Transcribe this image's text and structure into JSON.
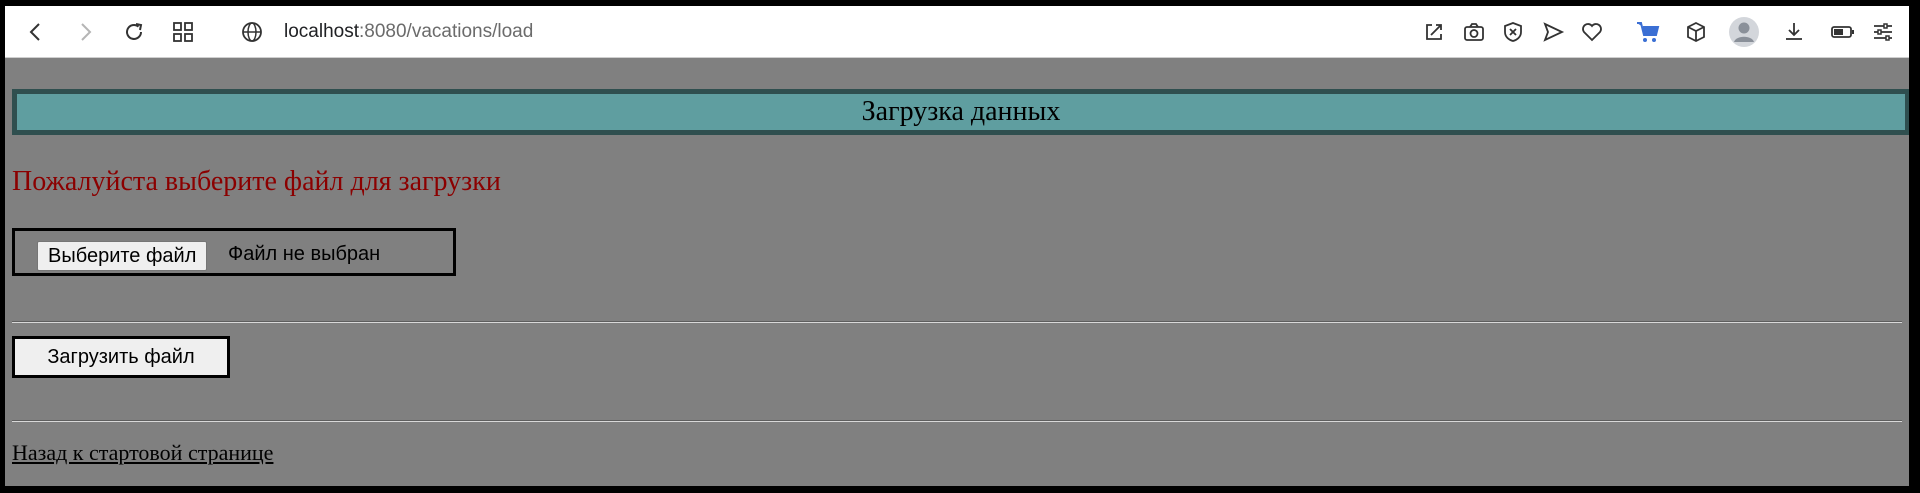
{
  "browser": {
    "url_host": "localhost",
    "url_path": ":8080/vacations/load",
    "icons": [
      "back-icon",
      "forward-icon",
      "reload-icon",
      "apps-grid-icon",
      "site-info-globe-icon",
      "share-edit-icon",
      "camera-icon",
      "shield-x-icon",
      "send-icon",
      "heart-icon",
      "cart-icon",
      "box-icon",
      "profile-icon",
      "download-icon",
      "battery-icon",
      "settings-sliders-icon"
    ]
  },
  "page": {
    "header_title": "Загрузка данных",
    "prompt": "Пожалуйста выберите файл для загрузки",
    "choose_file_label": "Выберите файл",
    "no_file_text": "Файл не выбран",
    "upload_label": "Загрузить файл",
    "back_link": "Назад к стартовой странице"
  },
  "colors": {
    "page_background": "#808080",
    "header_background": "#5f9ea0",
    "header_border": "#2f4f4f",
    "prompt_text": "#8b0000",
    "cart_accent": "#3b6fd4"
  }
}
